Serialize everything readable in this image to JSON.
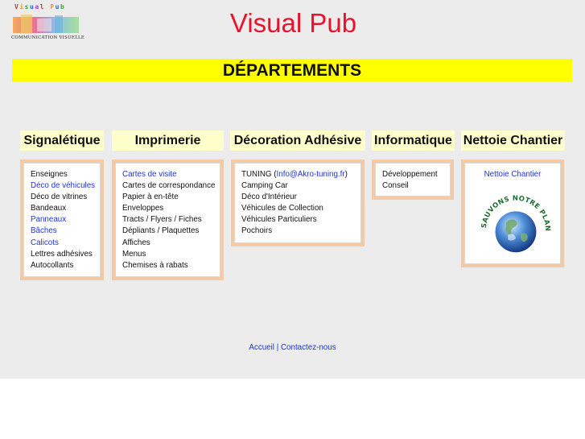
{
  "logo": {
    "title": "Visual Pub",
    "subtitle": "COMMUNICATION VISUELLE"
  },
  "site_title": "Visual Pub",
  "banner": "DÉPARTEMENTS",
  "columns": [
    {
      "heading": "Signalétique",
      "items": [
        {
          "label": "Enseignes",
          "link": false
        },
        {
          "label": "Déco de véhicules",
          "link": true
        },
        {
          "label": "Déco de vitrines",
          "link": false
        },
        {
          "label": "Bandeaux",
          "link": false
        },
        {
          "label": "Panneaux",
          "link": true
        },
        {
          "label": "Bâches",
          "link": true
        },
        {
          "label": "Calicots",
          "link": true
        },
        {
          "label": "Lettres adhésives",
          "link": false
        },
        {
          "label": "Autocollants",
          "link": false
        }
      ]
    },
    {
      "heading": "Imprimerie",
      "items": [
        {
          "label": "Cartes de visite",
          "link": true
        },
        {
          "label": "Cartes de correspondance",
          "link": false
        },
        {
          "label": "Papier à en-tête",
          "link": false
        },
        {
          "label": "Enveloppes",
          "link": false
        },
        {
          "label": "Tracts / Flyers / Fiches",
          "link": false
        },
        {
          "label": "Dépliants / Plaquettes",
          "link": false
        },
        {
          "label": "Affiches",
          "link": false
        },
        {
          "label": "Menus",
          "link": false
        },
        {
          "label": "Chemises à rabats",
          "link": false
        }
      ]
    },
    {
      "heading": "Décoration Adhésive",
      "tuning_prefix": "TUNING (",
      "tuning_email": "Info@Akro-tuning.fr",
      "tuning_suffix": ")",
      "items": [
        {
          "label": "Camping Car",
          "link": false
        },
        {
          "label": "Déco d'Intérieur",
          "link": false
        },
        {
          "label": "Véhicules de Collection",
          "link": false
        },
        {
          "label": "Véhicules Particuliers",
          "link": false
        },
        {
          "label": "Pochoirs",
          "link": false
        }
      ]
    },
    {
      "heading": "Informatique",
      "items": [
        {
          "label": "Développement",
          "link": false
        },
        {
          "label": "Conseil",
          "link": false
        }
      ]
    },
    {
      "heading": "Nettoie Chantier",
      "link_label": "Nettoie Chantier",
      "emblem_text": "SAUVONS NOTRE PLANETE"
    }
  ],
  "footer": {
    "home": "Accueil",
    "separator": " | ",
    "contact": "Contactez-nous"
  },
  "colors": {
    "title_red": "#e8132b",
    "banner_yellow": "#ffff00",
    "heading_bg": "#ffffcc",
    "box_border": "#f4c9a6",
    "link_blue": "#1f35d6",
    "page_grey": "#ececec"
  }
}
